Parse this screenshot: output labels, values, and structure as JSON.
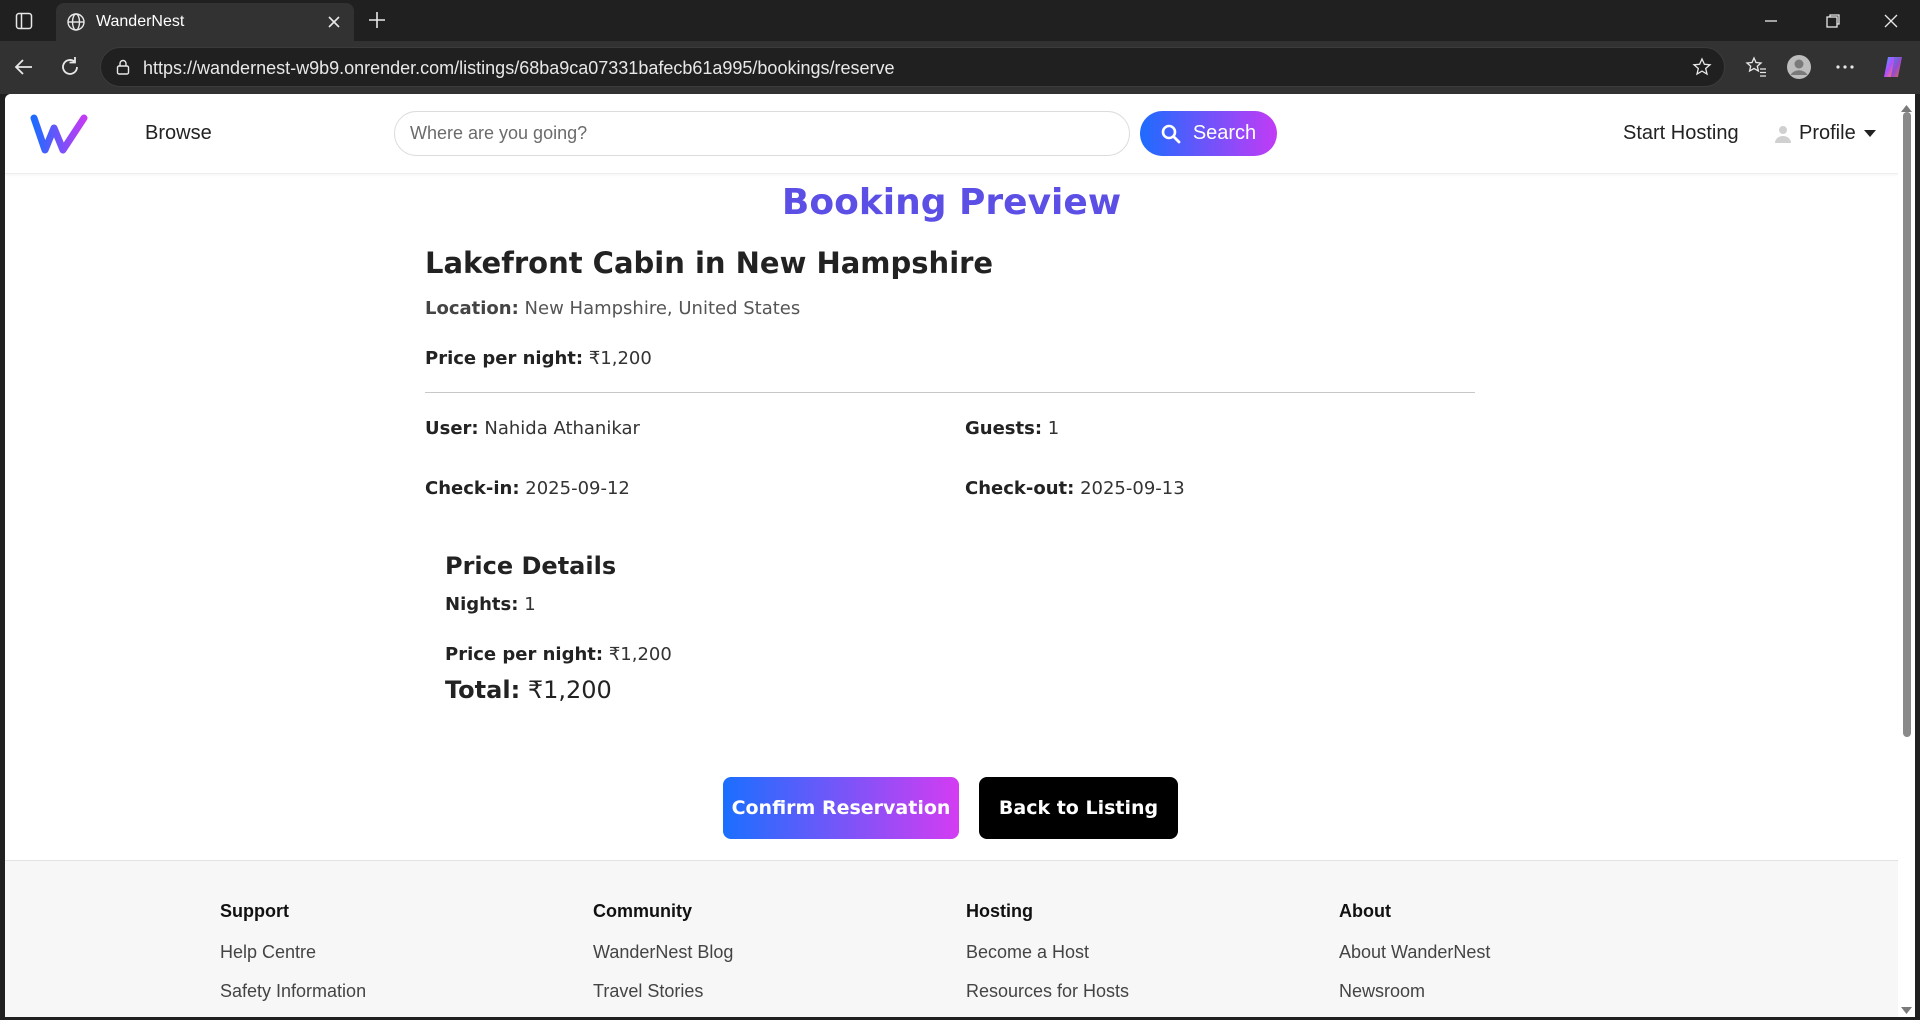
{
  "browser": {
    "tab_title": "WanderNest",
    "url": "https://wandernest-w9b9.onrender.com/listings/68ba9ca07331bafecb61a995/bookings/reserve"
  },
  "nav": {
    "browse": "Browse",
    "search_placeholder": "Where are you going?",
    "search_button": "Search",
    "start_hosting": "Start Hosting",
    "profile": "Profile"
  },
  "booking": {
    "heading": "Booking Preview",
    "listing_title": "Lakefront Cabin in New Hampshire",
    "location_label": "Location:",
    "location": "New Hampshire, United States",
    "price_label": "Price per night:",
    "price": "₹1,200",
    "user_label": "User:",
    "user": "Nahida Athanikar",
    "guests_label": "Guests:",
    "guests": "1",
    "checkin_label": "Check-in:",
    "checkin": "2025-09-12",
    "checkout_label": "Check-out:",
    "checkout": "2025-09-13"
  },
  "price_details": {
    "title": "Price Details",
    "nights_label": "Nights:",
    "nights": "1",
    "price_label": "Price per night:",
    "price": "₹1,200",
    "total_label": "Total:",
    "total": "₹1,200"
  },
  "actions": {
    "confirm": "Confirm Reservation",
    "back": "Back to Listing"
  },
  "footer": {
    "columns": [
      {
        "heading": "Support",
        "links": [
          "Help Centre",
          "Safety Information"
        ]
      },
      {
        "heading": "Community",
        "links": [
          "WanderNest Blog",
          "Travel Stories"
        ]
      },
      {
        "heading": "Hosting",
        "links": [
          "Become a Host",
          "Resources for Hosts"
        ]
      },
      {
        "heading": "About",
        "links": [
          "About WanderNest",
          "Newsroom"
        ]
      }
    ]
  },
  "colors": {
    "accent_start": "#1e6bff",
    "accent_end": "#c23bf5",
    "heading": "#5b4fe6"
  }
}
